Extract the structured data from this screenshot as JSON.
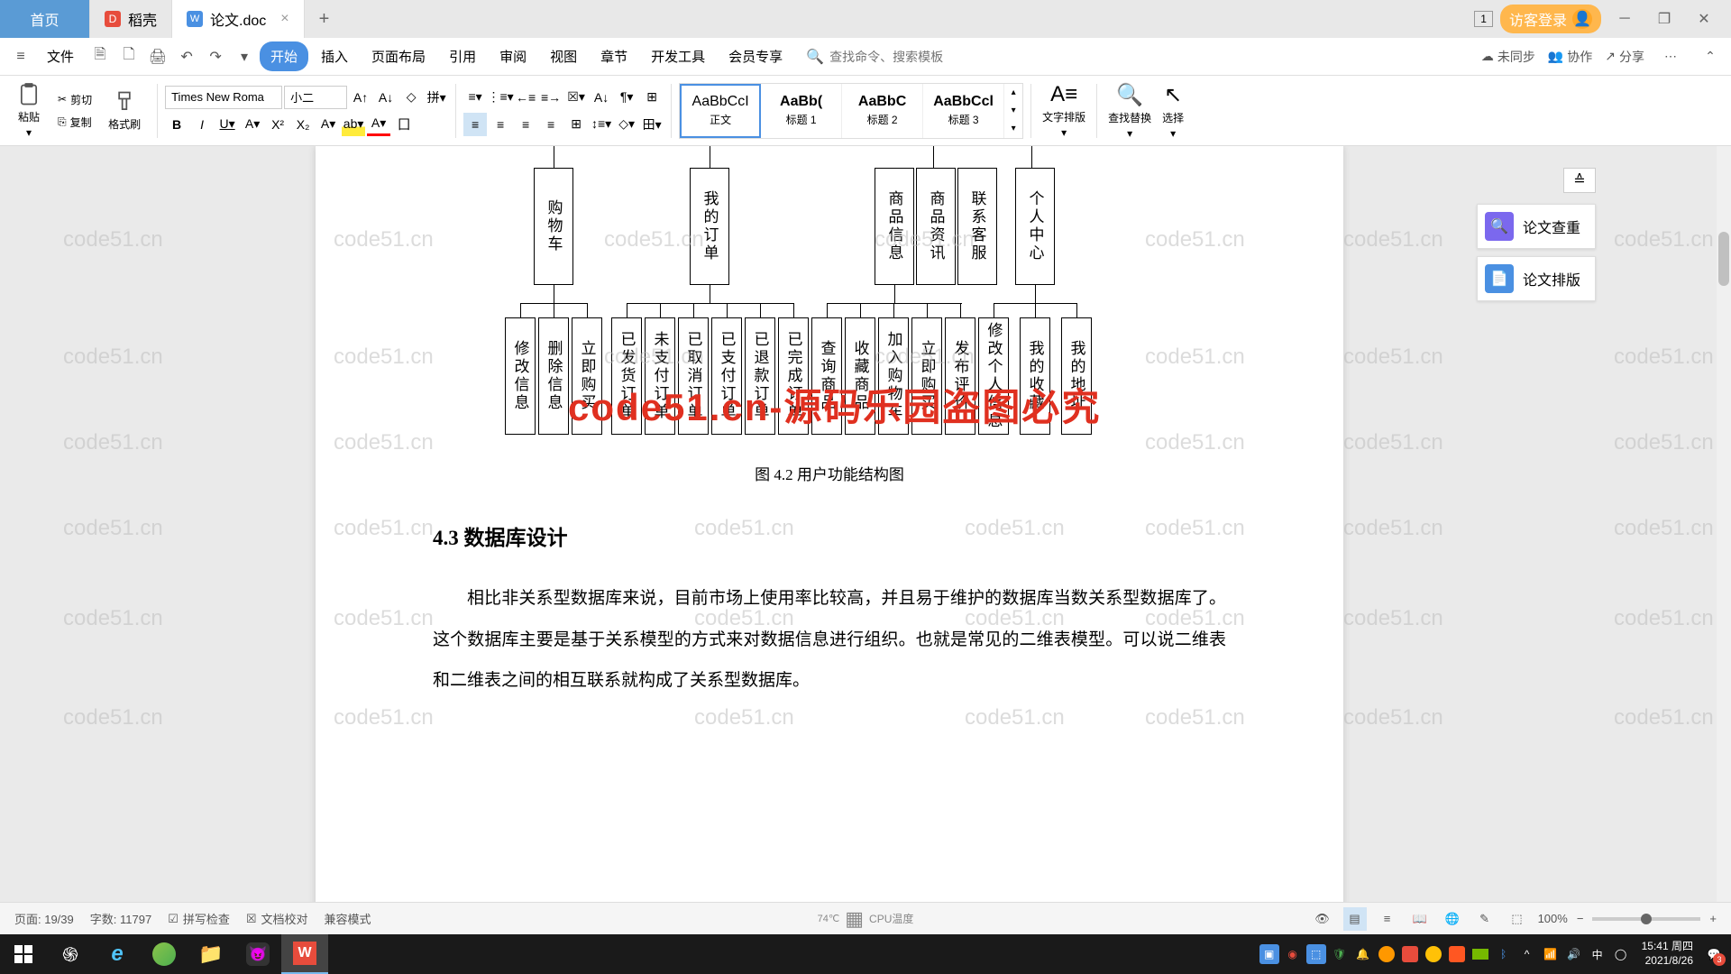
{
  "titlebar": {
    "tabs": [
      {
        "label": "首页",
        "type": "home"
      },
      {
        "label": "稻壳",
        "icon": "docer",
        "color": "#e74c3c"
      },
      {
        "label": "论文.doc",
        "icon": "doc",
        "color": "#4a90e2",
        "active": true
      }
    ],
    "badge": "1",
    "login": "访客登录"
  },
  "menubar": {
    "file": "文件",
    "items": [
      "开始",
      "插入",
      "页面布局",
      "引用",
      "审阅",
      "视图",
      "章节",
      "开发工具",
      "会员专享"
    ],
    "active_index": 0,
    "search_placeholder": "查找命令、搜索模板",
    "right": {
      "sync": "未同步",
      "collab": "协作",
      "share": "分享"
    }
  },
  "toolbar": {
    "paste": "粘贴",
    "cut": "剪切",
    "copy": "复制",
    "format": "格式刷",
    "font_name": "Times New Roma",
    "font_size": "小二",
    "styles": [
      {
        "preview": "AaBbCcI",
        "label": "正文"
      },
      {
        "preview": "AaBb(",
        "label": "标题 1",
        "bold": true
      },
      {
        "preview": "AaBbC",
        "label": "标题 2",
        "bold": true
      },
      {
        "preview": "AaBbCcl",
        "label": "标题 3",
        "bold": true
      }
    ],
    "text_layout": "文字排版",
    "find": "查找替换",
    "select": "选择"
  },
  "document": {
    "diagram_top": [
      "购物车",
      "我的订单",
      "商品信息",
      "商品资讯",
      "联系客服",
      "个人中心"
    ],
    "diagram_bottom": [
      "修改信息",
      "删除信息",
      "立即购买",
      "已发货订单",
      "未支付订单",
      "已取消订单",
      "已支付订单",
      "已退款订单",
      "已完成订单",
      "查询商品",
      "收藏商品",
      "加入购物车",
      "立即购买",
      "发布评价",
      "修改个人信息",
      "我的收藏",
      "我的地址"
    ],
    "caption": "图 4.2  用户功能结构图",
    "heading": "4.3 数据库设计",
    "para": "相比非关系型数据库来说，目前市场上使用率比较高，并且易于维护的数据库当数关系型数据库了。这个数据库主要是基于关系模型的方式来对数据信息进行组织。也就是常见的二维表模型。可以说二维表和二维表之间的相互联系就构成了关系型数据库。",
    "red_watermark": "code51.cn-源码乐园盗图必究"
  },
  "side_panel": {
    "btn1": "论文查重",
    "btn2": "论文排版"
  },
  "statusbar": {
    "page": "页面: 19/39",
    "words": "字数: 11797",
    "spell": "拼写检查",
    "docCheck": "文档校对",
    "compat": "兼容模式",
    "cpu": "CPU温度",
    "temp": "74℃",
    "zoom": "100%"
  },
  "taskbar": {
    "time": "15:41",
    "day": "周四",
    "date": "2021/8/26",
    "badge": "3"
  },
  "watermark_text": "code51.cn"
}
